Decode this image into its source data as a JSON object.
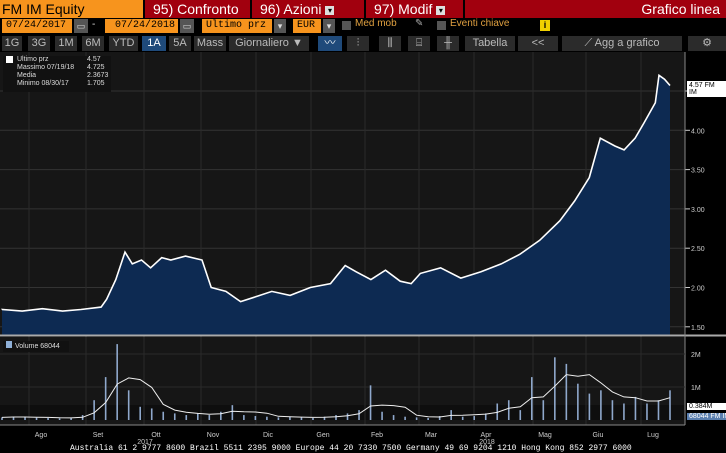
{
  "header": {
    "ticker": "FM IM Equity",
    "compare": "95) Confronto",
    "actions": "96) Azioni",
    "edit": "97) Modif",
    "chart_type": "Grafico linea"
  },
  "controls": {
    "start_date": "07/24/2017",
    "separator": "-",
    "end_date": "07/24/2018",
    "field": "Ultimo prz",
    "currency": "EUR",
    "moving_avg": "Med mob",
    "key_events": "Eventi chiave",
    "info": "i"
  },
  "toolbar": {
    "periods": [
      "1G",
      "3G",
      "1M",
      "6M",
      "YTD",
      "1A",
      "5A",
      "Mass"
    ],
    "selected": "1A",
    "frequency": "Giornaliero ▼",
    "table": "Tabella",
    "collapse": "<<",
    "add_to_chart": "Agg a grafico"
  },
  "legend": {
    "rows": [
      {
        "label": "Ultimo prz",
        "value": "4.57"
      },
      {
        "label": "Massimo 07/19/18",
        "value": "4.725"
      },
      {
        "label": "Media",
        "value": "2.3673"
      },
      {
        "label": "Minimo 08/30/17",
        "value": "1.705"
      }
    ]
  },
  "price_tag": "4.57 FM IM",
  "volume_legend": "Volume 68044",
  "volume_tag_ma": "0.384M",
  "volume_tag_last": "68044 FM IM",
  "footer": "Australia 61 2 9777 8600 Brazil 5511 2395 9000 Europe 44 20 7330 7500 Germany 49 69 9204 1210 Hong Kong 852 2977 6000",
  "colors": {
    "orange": "#f7941d",
    "red": "#a1000e",
    "area": "#0d2a52"
  },
  "chart_data": {
    "type": "area",
    "price": {
      "name": "Ultimo prz",
      "start": "2017-07-24",
      "days": [
        0,
        11,
        22,
        33,
        43,
        54,
        57,
        62,
        67,
        71,
        76,
        81,
        87,
        92,
        100,
        109,
        114,
        122,
        130,
        138,
        147,
        157,
        168,
        179,
        187,
        193,
        201,
        209,
        217,
        223,
        228,
        239,
        250,
        261,
        272,
        282,
        293,
        304,
        312,
        320,
        326,
        334,
        339,
        345,
        350,
        356,
        358,
        361,
        364
      ],
      "values": [
        1.72,
        1.7,
        1.73,
        1.7,
        1.72,
        1.75,
        1.85,
        2.1,
        2.45,
        2.3,
        2.35,
        2.25,
        2.38,
        2.35,
        2.4,
        2.35,
        2.0,
        1.95,
        1.82,
        1.88,
        1.95,
        1.9,
        2.0,
        2.05,
        2.28,
        2.2,
        2.1,
        2.22,
        2.08,
        2.05,
        2.18,
        2.25,
        2.12,
        2.2,
        2.3,
        2.42,
        2.6,
        2.85,
        3.1,
        3.4,
        3.9,
        3.8,
        3.75,
        3.9,
        4.1,
        4.35,
        4.7,
        4.65,
        4.57
      ]
    },
    "yticks": [
      "4.50",
      "4.00",
      "3.50",
      "3.00",
      "2.50",
      "2.00",
      "1.50"
    ],
    "ylim": [
      1.4,
      4.8
    ],
    "volume": {
      "name": "Volume",
      "unit": "K",
      "values": [
        80,
        100,
        90,
        70,
        60,
        50,
        70,
        150,
        600,
        1300,
        2300,
        900,
        400,
        350,
        250,
        200,
        150,
        200,
        150,
        250,
        450,
        150,
        120,
        100,
        80,
        90,
        80,
        60,
        100,
        150,
        200,
        300,
        1050,
        250,
        150,
        100,
        80,
        60,
        120,
        300,
        100,
        120,
        200,
        500,
        600,
        300,
        1300,
        600,
        1900,
        1700,
        1100,
        800,
        900,
        600,
        500,
        700,
        500,
        600,
        900
      ]
    },
    "vticks": [
      "2M",
      "1M"
    ],
    "months": [
      "Ago",
      "Set",
      "Ott",
      "Nov",
      "Dic",
      "Gen",
      "Feb",
      "Mar",
      "Apr",
      "Mag",
      "Giu",
      "Lug"
    ],
    "years": [
      "2017",
      "2018"
    ]
  }
}
